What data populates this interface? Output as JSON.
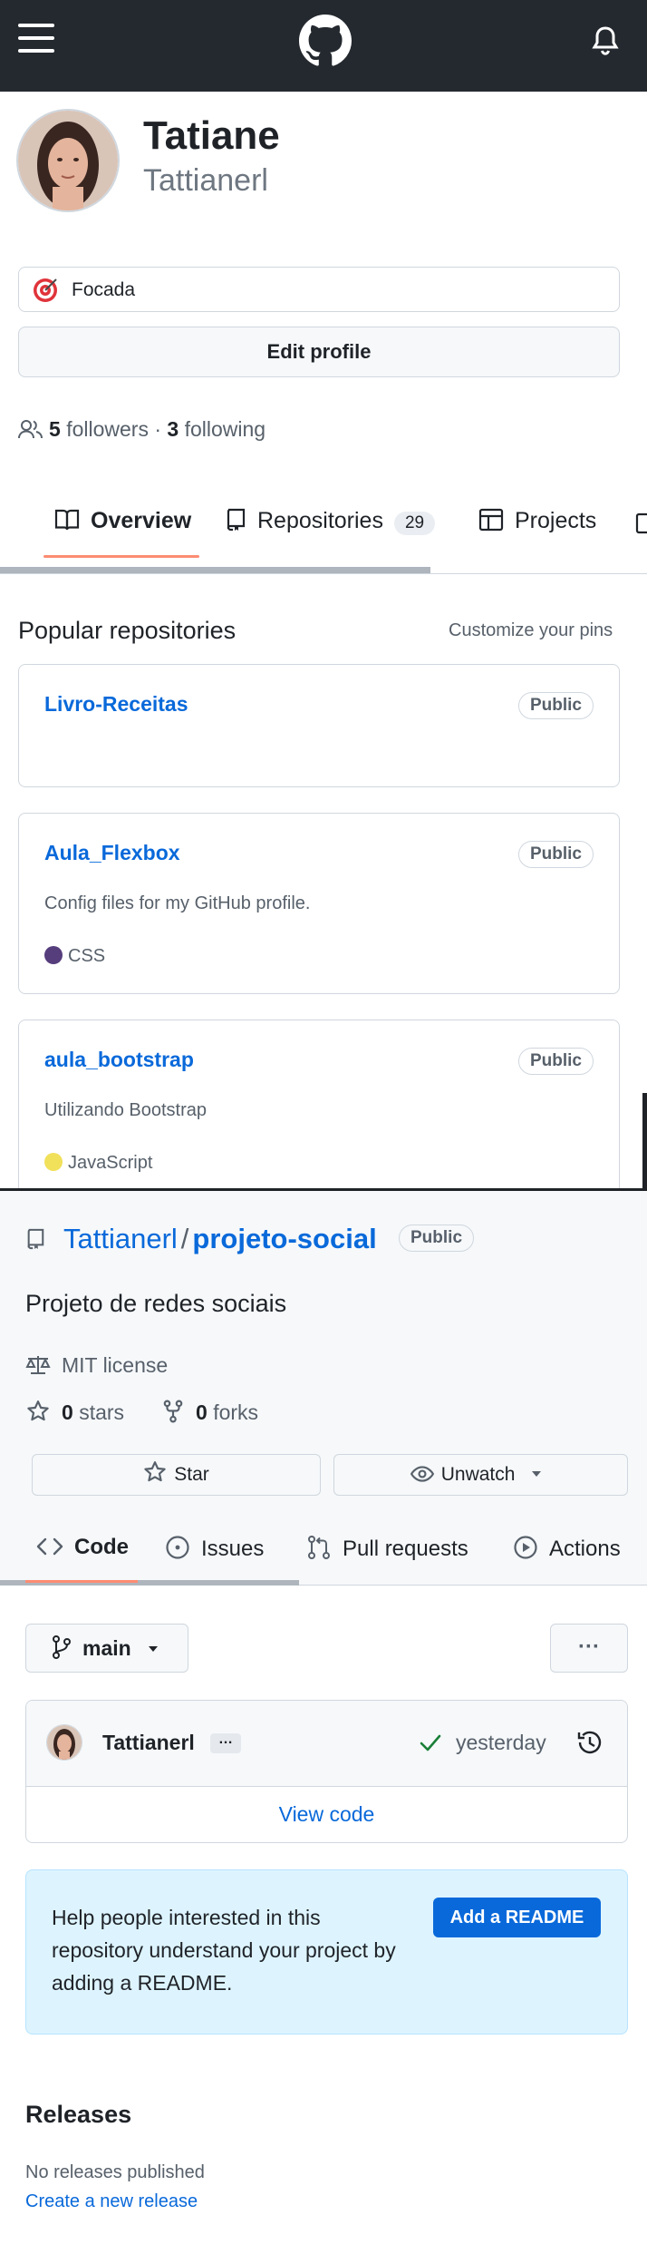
{
  "header": {
    "menu_icon": "hamburger-menu-icon",
    "logo_icon": "github-logo-icon",
    "notification_icon": "bell-icon"
  },
  "profile": {
    "name": "Tatiane",
    "login": "Tattianerl",
    "status": "Focada",
    "status_icon": "target-icon",
    "edit_label": "Edit profile",
    "followers_count": "5",
    "followers_label": "followers",
    "separator": "·",
    "following_count": "3",
    "following_label": "following"
  },
  "profile_tabs": [
    {
      "label": "Overview",
      "icon": "book-icon",
      "selected": true
    },
    {
      "label": "Repositories",
      "icon": "repo-icon",
      "count": "29"
    },
    {
      "label": "Projects",
      "icon": "table-icon"
    }
  ],
  "popular": {
    "title": "Popular repositories",
    "customize_label": "Customize your pins",
    "repos": [
      {
        "name": "Livro-Receitas",
        "visibility": "Public",
        "description": "",
        "language": "",
        "lang_color": ""
      },
      {
        "name": "Aula_Flexbox",
        "visibility": "Public",
        "description": "Config files for my GitHub profile.",
        "language": "CSS",
        "lang_color": "#563d7c"
      },
      {
        "name": "aula_bootstrap",
        "visibility": "Public",
        "description": "Utilizando Bootstrap",
        "language": "JavaScript",
        "lang_color": "#f1e05a"
      }
    ]
  },
  "repo": {
    "owner": "Tattianerl",
    "slash": "/",
    "name": "projeto-social",
    "visibility": "Public",
    "description": "Projeto de redes sociais",
    "license": "MIT license",
    "stars_count": "0",
    "stars_label": "stars",
    "forks_count": "0",
    "forks_label": "forks",
    "star_label": "Star",
    "watch_label": "Unwatch",
    "tabs": [
      {
        "label": "Code",
        "icon": "code-icon",
        "selected": true
      },
      {
        "label": "Issues",
        "icon": "issue-icon"
      },
      {
        "label": "Pull requests",
        "icon": "pull-request-icon"
      },
      {
        "label": "Actions",
        "icon": "play-icon"
      }
    ],
    "branch": "main",
    "more_label": "···",
    "commit_user": "Tattianerl",
    "commit_ellipsis": "…",
    "commit_time": "yesterday",
    "view_code_label": "View code",
    "readme_prompt": "Help people interested in this repository understand your project by adding a README.",
    "readme_button": "Add a README",
    "releases_title": "Releases",
    "no_releases": "No releases published",
    "create_release": "Create a new release"
  },
  "colors": {
    "header_bg": "#24292f",
    "link": "#0969da",
    "tab_underline": "#fd8c73",
    "readme_bg": "#ddf4ff"
  }
}
